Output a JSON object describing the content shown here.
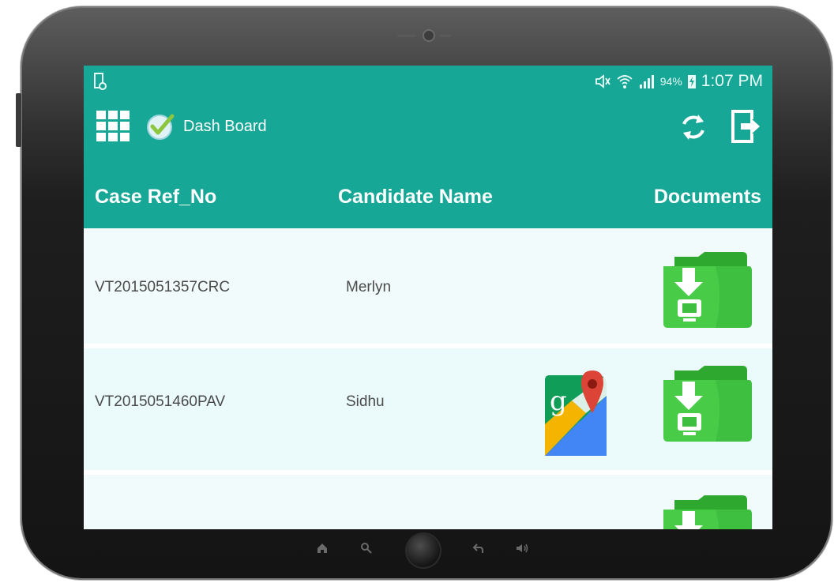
{
  "status_bar": {
    "battery_percent": "94%",
    "time": "1:07 PM"
  },
  "toolbar": {
    "title": "Dash Board",
    "icons": {
      "menu": "grid-menu-icon",
      "logo": "check-badge-icon",
      "refresh": "refresh-icon",
      "logout": "logout-icon"
    }
  },
  "table": {
    "headers": {
      "case_ref": "Case Ref_No",
      "candidate_name": "Candidate Name",
      "documents": "Documents"
    },
    "rows": [
      {
        "case_ref": "VT2015051357CRC",
        "candidate_name": "Merlyn",
        "has_map": false
      },
      {
        "case_ref": "VT2015051460PAV",
        "candidate_name": "Sidhu",
        "has_map": true
      }
    ]
  },
  "colors": {
    "accent": "#16a796",
    "row_bg": "#f1fbfb",
    "folder_green": "#3fbf3f"
  }
}
